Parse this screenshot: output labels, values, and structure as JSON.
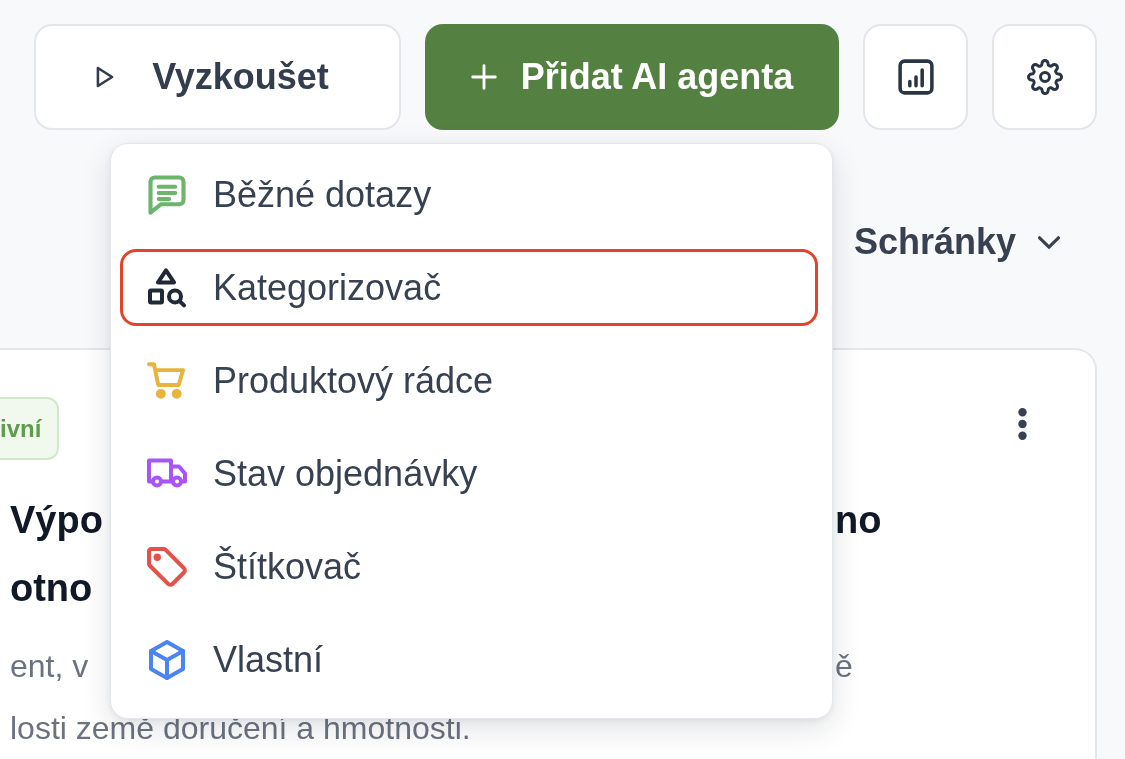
{
  "toolbar": {
    "try_button": {
      "label": "Vyzkoušet"
    },
    "add_agent_button": {
      "label": "Přidat AI agenta"
    }
  },
  "inbox_filter": {
    "label": "Schránky"
  },
  "agent_card": {
    "status_badge": "ivní",
    "title_lines": [
      {
        "fragments": [
          "Výpo",
          "no"
        ]
      },
      {
        "fragments": [
          "otno"
        ]
      }
    ],
    "description_lines": [
      {
        "fragments": [
          "ent, v",
          "ě"
        ]
      },
      {
        "fragments": [
          "losti země doručení a hmotnosti."
        ]
      }
    ]
  },
  "add_agent_menu": {
    "items": [
      {
        "label": "Běžné dotazy",
        "color": "#6db46c",
        "highlighted": false
      },
      {
        "label": "Kategorizovač",
        "color": "#1f2937",
        "highlighted": true
      },
      {
        "label": "Produktový rádce",
        "color": "#e9b43b",
        "highlighted": false
      },
      {
        "label": "Stav objednávky",
        "color": "#a855f7",
        "highlighted": false
      },
      {
        "label": "Štítkovač",
        "color": "#e0524a",
        "highlighted": false
      },
      {
        "label": "Vlastní",
        "color": "#4a85f2",
        "highlighted": false
      }
    ]
  }
}
